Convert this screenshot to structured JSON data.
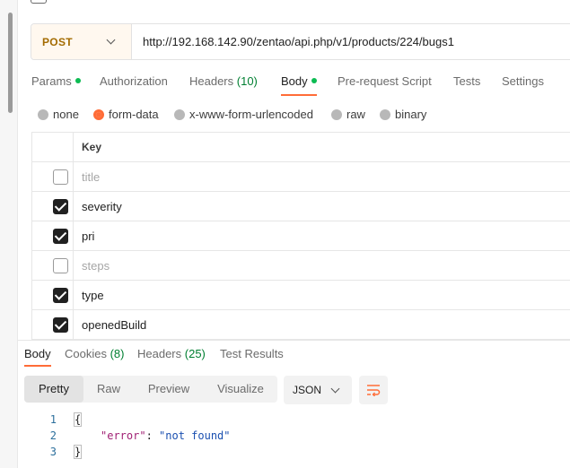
{
  "request": {
    "method": "POST",
    "url": "http://192.168.142.90/zentao/api.php/v1/products/224/bugs1"
  },
  "request_tabs": [
    {
      "label": "Params",
      "count": "",
      "dot": true
    },
    {
      "label": "Authorization",
      "count": "",
      "dot": false
    },
    {
      "label": "Headers",
      "count": "(10)",
      "dot": false
    },
    {
      "label": "Body",
      "count": "",
      "dot": true,
      "active": true
    },
    {
      "label": "Pre-request Script",
      "count": "",
      "dot": false
    },
    {
      "label": "Tests",
      "count": "",
      "dot": false
    },
    {
      "label": "Settings",
      "count": "",
      "dot": false
    }
  ],
  "body_types": [
    "none",
    "form-data",
    "x-www-form-urlencoded",
    "raw",
    "binary"
  ],
  "body_type_selected": "form-data",
  "form_table": {
    "key_header": "Key",
    "rows": [
      {
        "key": "title",
        "checked": false
      },
      {
        "key": "severity",
        "checked": true
      },
      {
        "key": "pri",
        "checked": true
      },
      {
        "key": "steps",
        "checked": false
      },
      {
        "key": "type",
        "checked": true
      },
      {
        "key": "openedBuild",
        "checked": true
      }
    ]
  },
  "response_tabs": [
    {
      "label": "Body",
      "count": "",
      "active": true
    },
    {
      "label": "Cookies",
      "count": "(8)"
    },
    {
      "label": "Headers",
      "count": "(25)"
    },
    {
      "label": "Test Results",
      "count": ""
    }
  ],
  "view_modes": [
    "Pretty",
    "Raw",
    "Preview",
    "Visualize"
  ],
  "view_mode_selected": "Pretty",
  "format": "JSON",
  "response_code": {
    "lines": [
      "1",
      "2",
      "3"
    ],
    "open_brace": "{",
    "close_brace": "}",
    "key": "\"error\"",
    "colon": ": ",
    "value": "\"not found\""
  },
  "icons": {
    "back": "back-arrow-icon",
    "method_dropdown": "chevron-down-icon",
    "format_dropdown": "chevron-down-icon",
    "wrap": "wrap-lines-icon"
  },
  "colors": {
    "accent": "#ff6c37",
    "method_post": "#a36b00",
    "count_green": "#007f31",
    "dot_green": "#0cbb52"
  }
}
